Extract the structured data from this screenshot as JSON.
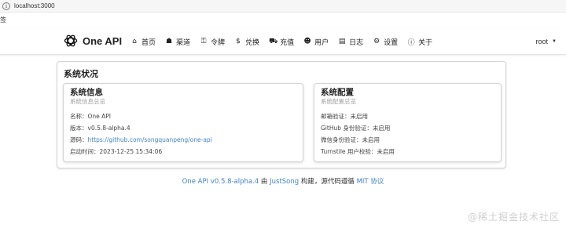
{
  "browser": {
    "url": "localhost:3000"
  },
  "bookmarks": {
    "label": "签"
  },
  "navbar": {
    "brand": "One API",
    "items": [
      {
        "icon": "home-icon",
        "glyph": "⌂",
        "label": "首页"
      },
      {
        "icon": "sitemap-icon",
        "glyph": "☗",
        "label": "渠道"
      },
      {
        "icon": "key-icon",
        "glyph": "⚿",
        "label": "令牌"
      },
      {
        "icon": "dollar-icon",
        "glyph": "$",
        "label": "兑换"
      },
      {
        "icon": "cart-icon",
        "glyph": "⛟",
        "label": "充值"
      },
      {
        "icon": "user-icon",
        "glyph": "☻",
        "label": "用户"
      },
      {
        "icon": "book-icon",
        "glyph": "▤",
        "label": "日志"
      },
      {
        "icon": "gear-icon",
        "glyph": "⚙",
        "label": "设置"
      },
      {
        "icon": "info-icon",
        "glyph": "ⓘ",
        "label": "关于"
      }
    ],
    "user": "root"
  },
  "status": {
    "title": "系统状况",
    "system_info": {
      "title": "系统信息",
      "subtitle": "系统信息总览",
      "name": "名称：One API",
      "version": "版本：v0.5.8-alpha.4",
      "source_label": "源码：",
      "source_link": "https://github.com/songquanpeng/one-api",
      "start_time": "启动时间：2023-12-25 15:34:06"
    },
    "system_config": {
      "title": "系统配置",
      "subtitle": "系统配置总览",
      "email_verify": "邮箱验证：未启用",
      "github_oauth": "GitHub 身份验证：未启用",
      "wechat_auth": "微信身份验证：未启用",
      "turnstile": "Turnstile 用户校验：未启用"
    }
  },
  "footer": {
    "project_link": "One API v0.5.8-alpha.4",
    "by": " 由 ",
    "author_link": "JustSong",
    "built": " 构建，源代码遵循 ",
    "license_link": "MIT 协议"
  },
  "watermark": "@稀土掘金技术社区"
}
